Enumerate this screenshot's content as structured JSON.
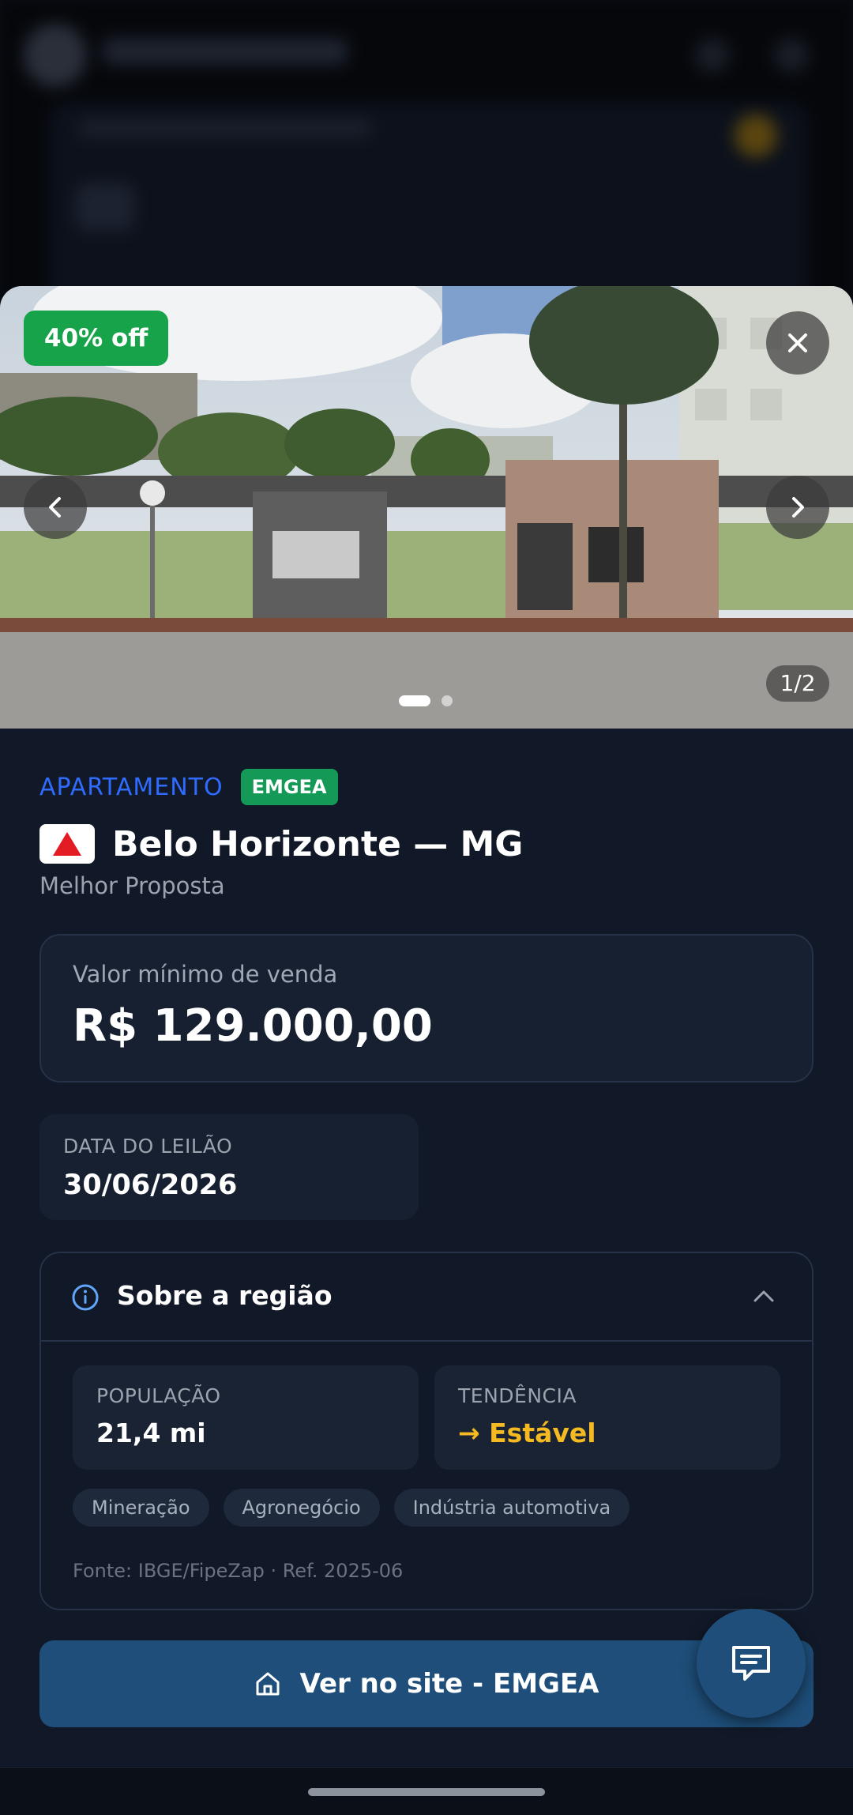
{
  "gallery": {
    "discount_badge": "40% off",
    "counter": "1/2",
    "total_images": 2,
    "active_image_index": 0
  },
  "property": {
    "type": "APARTAMENTO",
    "source_badge": "EMGEA",
    "city_title": "Belo Horizonte — MG",
    "modality": "Melhor Proposta"
  },
  "price": {
    "label": "Valor mínimo de venda",
    "value": "R$ 129.000,00"
  },
  "auction_date": {
    "label": "DATA DO LEILÃO",
    "value": "30/06/2026"
  },
  "region": {
    "title": "Sobre a região",
    "population_label": "POPULAÇÃO",
    "population_value": "21,4 mi",
    "trend_label": "TENDÊNCIA",
    "trend_value": "→ Estável",
    "chips": [
      "Mineração",
      "Agronegócio",
      "Indústria automotiva"
    ],
    "source": "Fonte: IBGE/FipeZap · Ref. 2025-06"
  },
  "cta": {
    "label": "Ver no site - EMGEA"
  },
  "colors": {
    "accent_blue": "#2f6bff",
    "discount_green": "#16a34a",
    "source_badge_green": "#159957",
    "trend_yellow": "#f5b921",
    "cta_blue": "#1e4e79",
    "sheet_bg": "#111827"
  },
  "icons": [
    "close-icon",
    "chevron-left-icon",
    "chevron-right-icon",
    "info-icon",
    "chevron-up-icon",
    "home-icon",
    "chat-icon",
    "state-flag-icon"
  ]
}
